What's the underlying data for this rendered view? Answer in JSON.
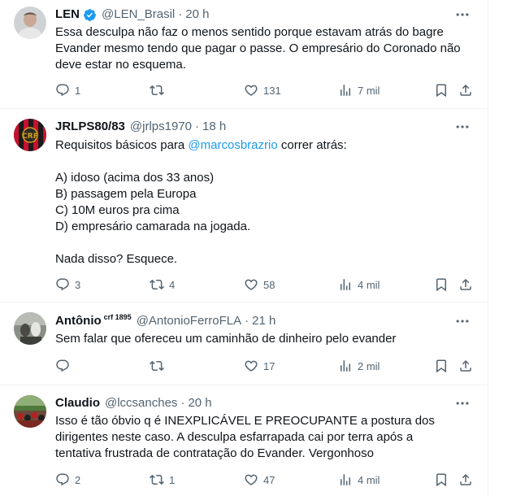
{
  "tweets": [
    {
      "name": "LEN",
      "handle": "@LEN_Brasil",
      "time": "20 h",
      "verified": true,
      "text": "Essa desculpa não faz o menos sentido porque estavam atrás do bagre\nEvander mesmo tendo que pagar o passe. O empresário do Coronado não\ndeve estar no esquema.",
      "replies": "1",
      "retweets": "",
      "likes": "131",
      "views": "7 mil"
    },
    {
      "name": "JRLPS80/83",
      "handle": "@jrlps1970",
      "time": "18 h",
      "text_before": "Requisitos básicos para ",
      "mention": "@marcosbrazrio",
      "text_after": " correr atrás:\n\nA) idoso (acima dos 33 anos)\nB) passagem pela Europa\nC) 10M euros pra cima\nD) empresário camarada na jogada.\n\nNada disso? Esquece.",
      "replies": "3",
      "retweets": "4",
      "likes": "58",
      "views": "4 mil"
    },
    {
      "name": "Antônio",
      "name_sup": "crf 1895",
      "handle": "@AntonioFerroFLA",
      "time": "21 h",
      "text": "Sem falar que ofereceu um caminhão de dinheiro pelo evander",
      "replies": "",
      "retweets": "",
      "likes": "17",
      "views": "2 mil"
    },
    {
      "name": "Claudio",
      "handle": "@lccsanches",
      "time": "20 h",
      "text": "Isso é tão óbvio q é INEXPLICÁVEL E PREOCUPANTE a postura dos\ndirigentes neste caso. A desculpa esfarrapada cai por terra após a\ntentativa frustrada de contratação do Evander. Vergonhoso",
      "replies": "2",
      "retweets": "1",
      "likes": "47",
      "views": "4 mil"
    }
  ],
  "colors": {
    "accent": "#1d9bf0",
    "secondary": "#536471",
    "text": "#0f1419",
    "border": "#eff3f4"
  },
  "icons": [
    "verified-badge-icon",
    "more-icon",
    "reply-icon",
    "retweet-icon",
    "like-icon",
    "views-icon",
    "bookmark-icon",
    "share-icon"
  ]
}
